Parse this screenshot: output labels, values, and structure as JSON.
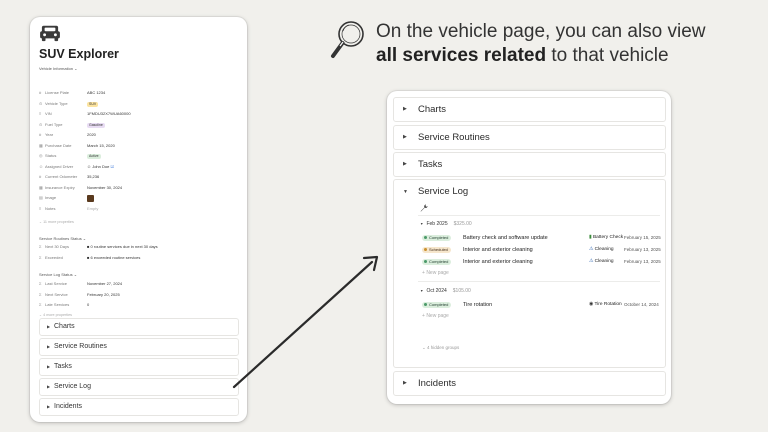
{
  "headline": {
    "line1": "On the vehicle page, you can also view",
    "line2_bold": "all services related",
    "line2_rest": " to that vehicle"
  },
  "left_page": {
    "title": "SUV Explorer",
    "vehicle_info_header": "Vehicle Information",
    "properties": [
      {
        "name": "License Plate",
        "value": "ABC 1234",
        "icon": "hash-icon"
      },
      {
        "name": "Vehicle Type",
        "value": "SUV",
        "icon": "select-icon",
        "tag_color": "#fbe3a0"
      },
      {
        "name": "VIN",
        "value": "1FMDU32X7WUA60000",
        "icon": "text-icon"
      },
      {
        "name": "Fuel Type",
        "value": "Gasoline",
        "icon": "select-icon",
        "tag_color": "#e8dcf3"
      },
      {
        "name": "Year",
        "value": "2020",
        "icon": "number-icon"
      },
      {
        "name": "Purchase Date",
        "value": "March 15, 2020",
        "icon": "calendar-icon"
      },
      {
        "name": "Status",
        "value": "Active",
        "icon": "status-icon",
        "tag_color": "#dbeedd"
      },
      {
        "name": "Assigned Driver",
        "value": "John Doe",
        "icon": "person-icon"
      },
      {
        "name": "Current Odometer",
        "value": "35,236",
        "icon": "number-icon"
      },
      {
        "name": "Insurance Expiry",
        "value": "November 30, 2024",
        "icon": "calendar-icon"
      },
      {
        "name": "Image",
        "value": "",
        "icon": "file-icon"
      },
      {
        "name": "Notes",
        "value": "Empty",
        "icon": "text-icon"
      }
    ],
    "more_props_1": "11 more properties",
    "service_routines_header": "Service Routines Status",
    "routines": [
      {
        "name": "Next 30 Days",
        "value": "0 routine services due in next 30 days",
        "icon": "formula-icon"
      },
      {
        "name": "Exceeded",
        "value": "6 exceeded routine services",
        "icon": "formula-icon"
      }
    ],
    "service_log_header": "Service Log Status",
    "log_props": [
      {
        "name": "Last Service",
        "value": "November 27, 2024",
        "icon": "formula-icon"
      },
      {
        "name": "Next Service",
        "value": "February 20, 2025",
        "icon": "formula-icon"
      },
      {
        "name": "Late Services",
        "value": "0",
        "icon": "formula-icon"
      }
    ],
    "more_props_2": "4 more properties",
    "toggles": [
      "Charts",
      "Service Routines",
      "Tasks",
      "Service Log",
      "Incidents"
    ]
  },
  "right_page": {
    "toggles_top": [
      "Charts",
      "Service Routines",
      "Tasks"
    ],
    "service_log_title": "Service Log",
    "groups": [
      {
        "label": "Feb 2025",
        "sum": "$325.00",
        "rows": [
          {
            "status": "Completed",
            "name": "Battery check and software update",
            "related": "Battery Check",
            "related_icon": "battery-icon",
            "date": "February 15, 2025"
          },
          {
            "status": "Scheduled",
            "name": "Interior and exterior cleaning",
            "related": "Cleaning",
            "related_icon": "spray-icon",
            "date": "February 13, 2025"
          },
          {
            "status": "Completed",
            "name": "Interior and exterior cleaning",
            "related": "Cleaning",
            "related_icon": "spray-icon",
            "date": "February 13, 2025"
          }
        ],
        "new_page": "New page"
      },
      {
        "label": "Oct 2024",
        "sum": "$105.00",
        "rows": [
          {
            "status": "Completed",
            "name": "Tire rotation",
            "related": "Tire Rotation",
            "related_icon": "tire-icon",
            "date": "October 14, 2024"
          }
        ],
        "new_page": "New page"
      }
    ],
    "hidden_groups": "4 hidden groups",
    "incidents": "Incidents"
  }
}
